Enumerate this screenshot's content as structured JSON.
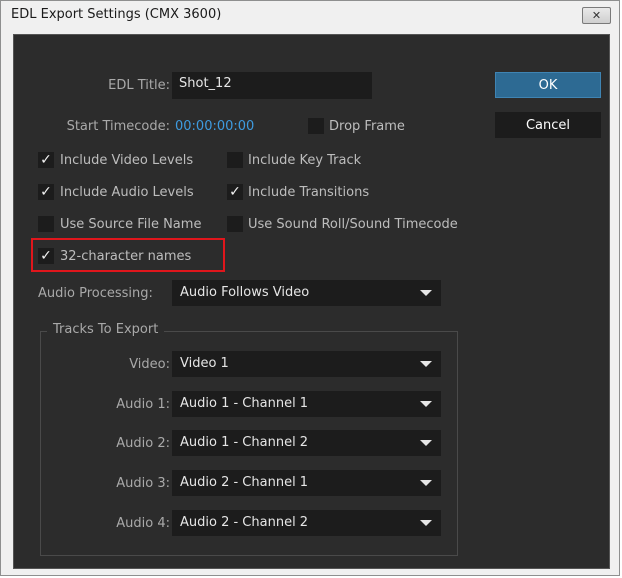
{
  "window": {
    "title": "EDL Export Settings (CMX 3600)",
    "close_glyph": "✕"
  },
  "edl_title": {
    "label": "EDL Title:",
    "value": "Shot_12"
  },
  "start_timecode": {
    "label": "Start Timecode:",
    "value": "00:00:00:00"
  },
  "drop_frame": {
    "label": "Drop Frame",
    "checked": false
  },
  "buttons": {
    "ok": "OK",
    "cancel": "Cancel"
  },
  "checkboxes": {
    "include_video_levels": {
      "label": "Include Video Levels",
      "checked": true
    },
    "include_key_track": {
      "label": "Include Key Track",
      "checked": false
    },
    "include_audio_levels": {
      "label": "Include Audio Levels",
      "checked": true
    },
    "include_transitions": {
      "label": "Include Transitions",
      "checked": true
    },
    "use_source_file_name": {
      "label": "Use Source File Name",
      "checked": false
    },
    "use_sound_roll": {
      "label": "Use Sound Roll/Sound Timecode",
      "checked": false
    },
    "char32_names": {
      "label": "32-character names",
      "checked": true
    }
  },
  "check_glyph": "✓",
  "audio_processing": {
    "label": "Audio Processing:",
    "value": "Audio Follows Video"
  },
  "tracks": {
    "group_label": "Tracks To Export",
    "video": {
      "label": "Video:",
      "value": "Video 1"
    },
    "audio1": {
      "label": "Audio 1:",
      "value": "Audio 1 - Channel 1"
    },
    "audio2": {
      "label": "Audio 2:",
      "value": "Audio 1 - Channel 2"
    },
    "audio3": {
      "label": "Audio 3:",
      "value": "Audio 2 - Channel 1"
    },
    "audio4": {
      "label": "Audio 4:",
      "value": "Audio 2 - Channel 2"
    }
  },
  "colors": {
    "panel_bg": "#2c2c2c",
    "field_bg": "#1c1c1c",
    "timecode": "#3e9be0",
    "ok_button": "#2d6a93",
    "highlight": "#e0161c"
  }
}
